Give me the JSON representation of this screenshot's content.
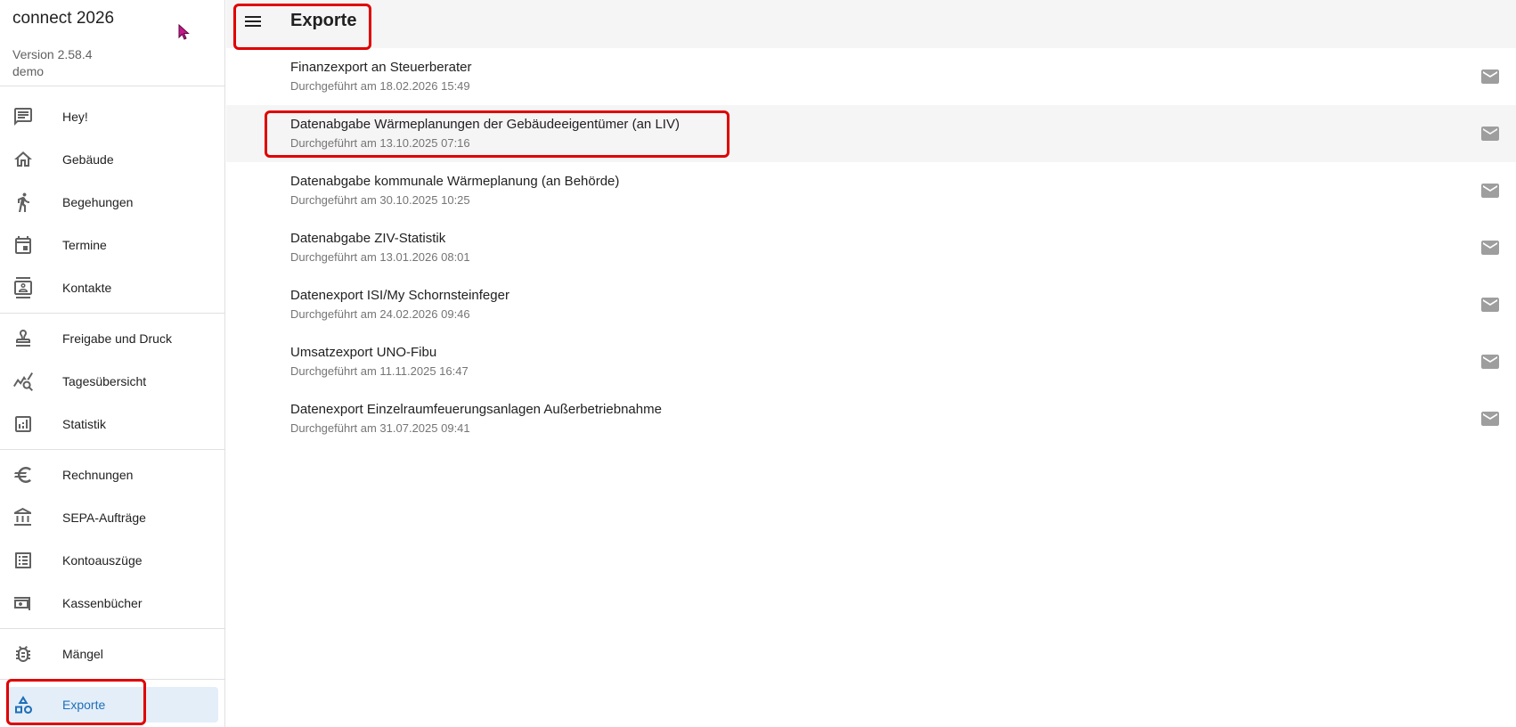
{
  "app": {
    "title": "connect 2026",
    "version": "Version 2.58.4",
    "user": "demo"
  },
  "header": {
    "title": "Exporte"
  },
  "sidebar": {
    "items": [
      {
        "label": "Hey!",
        "icon": "chat-icon"
      },
      {
        "label": "Gebäude",
        "icon": "home-icon"
      },
      {
        "label": "Begehungen",
        "icon": "walking-icon"
      },
      {
        "label": "Termine",
        "icon": "calendar-icon"
      },
      {
        "label": "Kontakte",
        "icon": "contacts-icon"
      },
      {
        "label": "Freigabe und Druck",
        "icon": "stamp-icon"
      },
      {
        "label": "Tagesübersicht",
        "icon": "chart-search-icon"
      },
      {
        "label": "Statistik",
        "icon": "bar-chart-icon"
      },
      {
        "label": "Rechnungen",
        "icon": "euro-icon"
      },
      {
        "label": "SEPA-Aufträge",
        "icon": "bank-icon"
      },
      {
        "label": "Kontoauszüge",
        "icon": "list-icon"
      },
      {
        "label": "Kassenbücher",
        "icon": "cash-icon"
      },
      {
        "label": "Mängel",
        "icon": "bug-icon"
      },
      {
        "label": "Exporte",
        "icon": "shapes-icon",
        "active": true
      }
    ]
  },
  "exports": [
    {
      "title": "Finanzexport an Steuerberater",
      "subtitle": "Durchgeführt am 18.02.2026 15:49"
    },
    {
      "title": "Datenabgabe Wärmeplanungen der Gebäudeeigentümer (an LIV)",
      "subtitle": "Durchgeführt am 13.10.2025 07:16"
    },
    {
      "title": "Datenabgabe kommunale Wärmeplanung (an Behörde)",
      "subtitle": "Durchgeführt am 30.10.2025 10:25"
    },
    {
      "title": "Datenabgabe ZIV-Statistik",
      "subtitle": "Durchgeführt am 13.01.2026 08:01"
    },
    {
      "title": "Datenexport ISI/My Schornsteinfeger",
      "subtitle": "Durchgeführt am 24.02.2026 09:46"
    },
    {
      "title": "Umsatzexport UNO-Fibu",
      "subtitle": "Durchgeführt am 11.11.2025 16:47"
    },
    {
      "title": "Datenexport Einzelraumfeuerungsanlagen Außerbetriebnahme",
      "subtitle": "Durchgeführt am 31.07.2025 09:41"
    }
  ],
  "colors": {
    "accent": "#1e6fb8",
    "active_bg": "#e3eef9",
    "annotation": "#e00000",
    "icon": "#616161"
  }
}
